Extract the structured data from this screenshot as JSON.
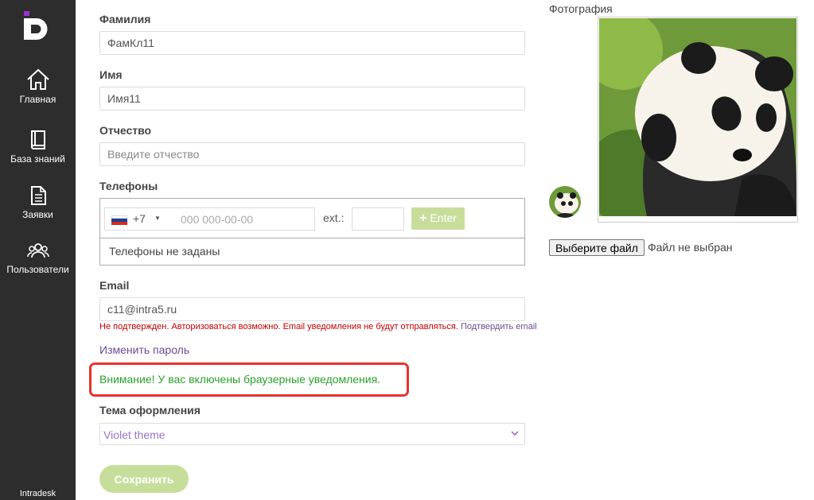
{
  "sidebar": {
    "items": [
      {
        "label": "Главная",
        "icon": "home-icon"
      },
      {
        "label": "База знаний",
        "icon": "book-icon"
      },
      {
        "label": "Заявки",
        "icon": "document-icon"
      },
      {
        "label": "Пользователи",
        "icon": "users-icon"
      }
    ],
    "brand": "Intradesk"
  },
  "form": {
    "last_name": {
      "label": "Фамилия",
      "value": "ФамКл11"
    },
    "first_name": {
      "label": "Имя",
      "value": "Имя11"
    },
    "middle_name": {
      "label": "Отчество",
      "placeholder": "Введите отчество"
    },
    "phones": {
      "label": "Телефоны",
      "country_code": "+7",
      "number_placeholder": "000 000-00-00",
      "ext_label": "ext.:",
      "enter_label": "Enter",
      "empty_text": "Телефоны не заданы"
    },
    "email": {
      "label": "Email",
      "value": "c11@intra5.ru",
      "warning": "Не подтвержден. Авторизоваться возможно. Email уведомления не будут отправляться.",
      "confirm_link": "Подтвердить email"
    },
    "change_password": "Изменить пароль",
    "browser_notice": "Внимание! У вас включены браузерные уведомления.",
    "theme": {
      "label": "Тема оформления",
      "value": "Violet theme"
    },
    "save_label": "Сохранить"
  },
  "photo": {
    "label": "Фотография",
    "choose_file": "Выберите файл",
    "no_file": "Файл не выбран"
  },
  "colors": {
    "sidebar_bg": "#2d2d2d",
    "accent_violet": "#6a4c93",
    "button_green": "#c7de9b",
    "alert_red": "#e8322e",
    "notice_green": "#28a22a"
  }
}
